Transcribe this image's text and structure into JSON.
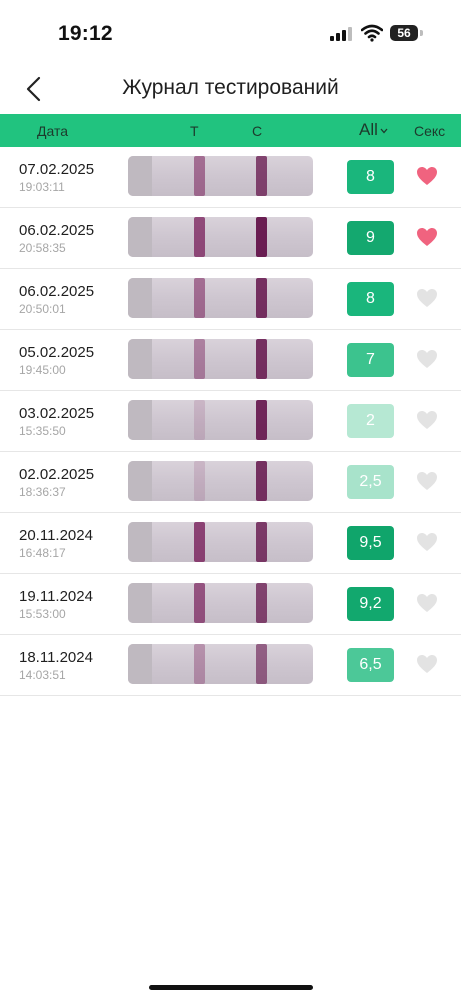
{
  "status": {
    "time": "19:12",
    "battery": "56"
  },
  "nav": {
    "title": "Журнал тестирований",
    "back_icon": "chevron-left-icon"
  },
  "header": {
    "date": "Дата",
    "t": "Т",
    "c": "С",
    "filter": "All",
    "sex": "Секс"
  },
  "colors": {
    "accent": "#21c37f",
    "heart_active": "#f0637f",
    "heart_inactive": "#e3e3e3"
  },
  "rows": [
    {
      "date": "07.02.2025",
      "time": "19:03:11",
      "score": "8",
      "sex": true,
      "score_color": "#1ab67c",
      "t_intensity": 0.55,
      "c_intensity": 0.75
    },
    {
      "date": "06.02.2025",
      "time": "20:58:35",
      "score": "9",
      "sex": true,
      "score_color": "#14a86f",
      "t_intensity": 0.75,
      "c_intensity": 0.95
    },
    {
      "date": "06.02.2025",
      "time": "20:50:01",
      "score": "8",
      "sex": false,
      "score_color": "#1ab67c",
      "t_intensity": 0.55,
      "c_intensity": 0.85
    },
    {
      "date": "05.02.2025",
      "time": "19:45:00",
      "score": "7",
      "sex": false,
      "score_color": "#3cc38e",
      "t_intensity": 0.45,
      "c_intensity": 0.85
    },
    {
      "date": "03.02.2025",
      "time": "15:35:50",
      "score": "2",
      "sex": false,
      "score_color": "#b6e8d3",
      "t_intensity": 0.15,
      "c_intensity": 0.9
    },
    {
      "date": "02.02.2025",
      "time": "18:36:37",
      "score": "2,5",
      "sex": false,
      "score_color": "#a8e3cb",
      "t_intensity": 0.15,
      "c_intensity": 0.85
    },
    {
      "date": "20.11.2024",
      "time": "16:48:17",
      "score": "9,5",
      "sex": false,
      "score_color": "#10a56b",
      "t_intensity": 0.8,
      "c_intensity": 0.8
    },
    {
      "date": "19.11.2024",
      "time": "15:53:00",
      "score": "9,2",
      "sex": false,
      "score_color": "#12a86e",
      "t_intensity": 0.7,
      "c_intensity": 0.75
    },
    {
      "date": "18.11.2024",
      "time": "14:03:51",
      "score": "6,5",
      "sex": false,
      "score_color": "#4cc898",
      "t_intensity": 0.35,
      "c_intensity": 0.6
    }
  ]
}
